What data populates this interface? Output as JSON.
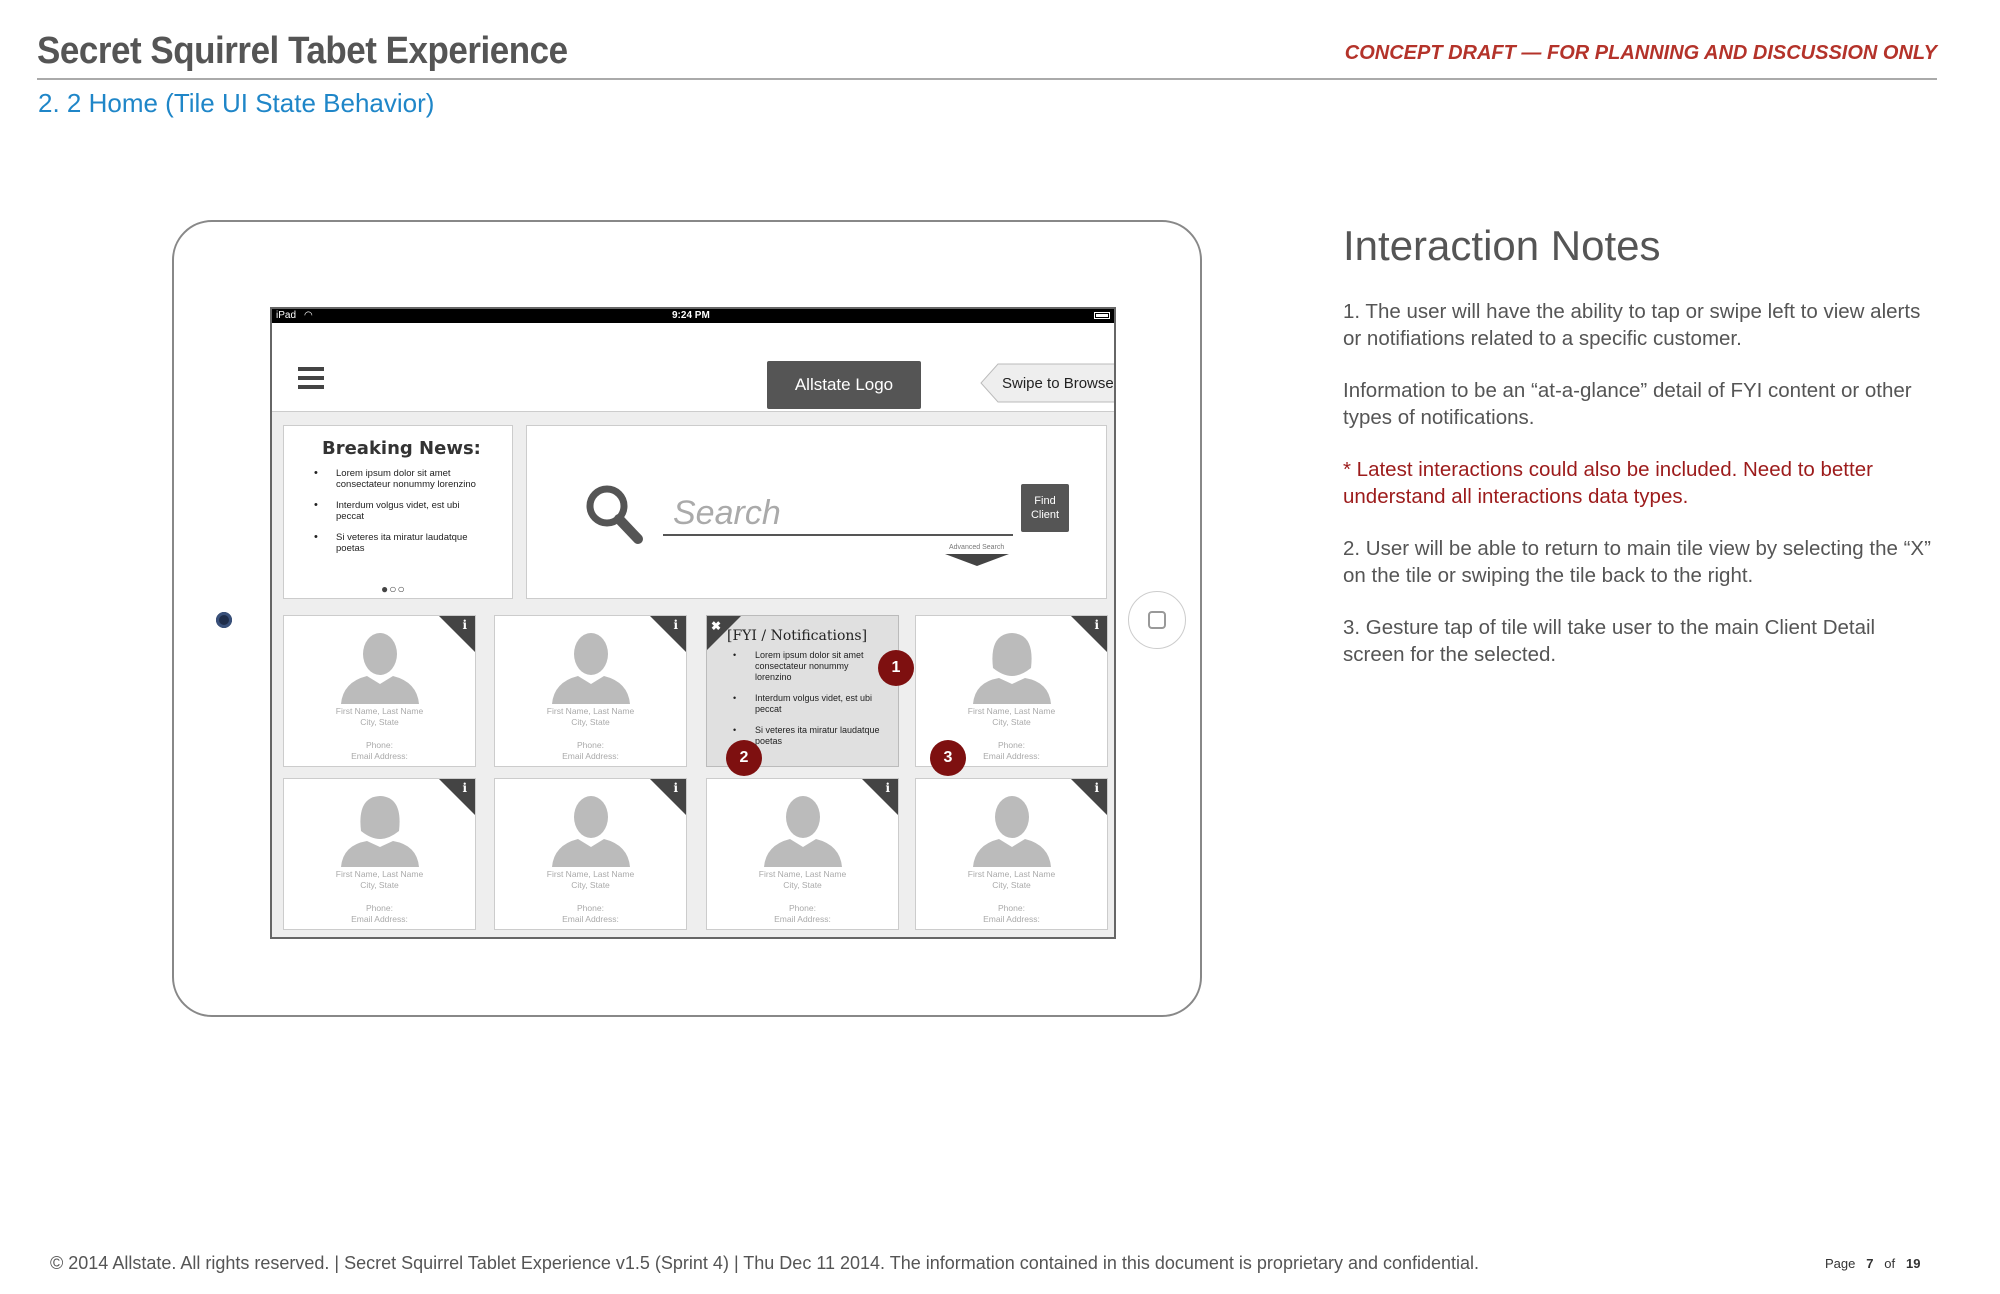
{
  "header": {
    "title": "Secret Squirrel Tabet Experience",
    "draft": "CONCEPT DRAFT — FOR PLANNING AND DISCUSSION ONLY",
    "subtitle": "2. 2 Home (Tile UI State Behavior)"
  },
  "screen": {
    "status": {
      "carrier": "iPad",
      "time": "9:24 PM"
    },
    "appbar": {
      "logo": "Allstate Logo",
      "swipe": "Swipe to Browse"
    },
    "news": {
      "title": "Breaking News:",
      "items": [
        "Lorem ipsum dolor sit amet consectateur nonummy lorenzino",
        "Interdum volgus videt, est ubi peccat",
        "Si veteres ita miratur laudatque poetas"
      ],
      "dots": "●○○"
    },
    "search": {
      "placeholder": "Search",
      "find_button": "Find Client",
      "advanced": "Advanced Search"
    },
    "fyi": {
      "title": "[FYI / Notifications]",
      "items": [
        "Lorem ipsum dolor sit amet consectateur nonummy lorenzino",
        "Interdum volgus videt, est ubi peccat",
        "Si veteres ita miratur laudatque poetas"
      ]
    },
    "tiles": [
      {
        "name": "First Name, Last Name",
        "location": "City, State",
        "phone": "Phone:",
        "email": "Email Address:"
      },
      {
        "name": "First Name, Last Name",
        "location": "City, State",
        "phone": "Phone:",
        "email": "Email Address:"
      },
      {
        "name": "First Name, Last Name",
        "location": "City, State",
        "phone": "Phone:",
        "email": "Email Address:"
      },
      {
        "name": "First Name, Last Name",
        "location": "City, State",
        "phone": "Phone:",
        "email": "Email Address:"
      },
      {
        "name": "First Name, Last Name",
        "location": "City, State",
        "phone": "Phone:",
        "email": "Email Address:"
      },
      {
        "name": "First Name, Last Name",
        "location": "City, State",
        "phone": "Phone:",
        "email": "Email Address:"
      },
      {
        "name": "First Name, Last Name",
        "location": "City, State",
        "phone": "Phone:",
        "email": "Email Address:"
      }
    ],
    "info_glyph": "i",
    "close_glyph": "✖",
    "markers": [
      "1",
      "2",
      "3"
    ]
  },
  "notes": {
    "title": "Interaction Notes",
    "n1": "1. The user will have the ability to tap or swipe left to view alerts or notifiations related to a specific customer.",
    "n1b": "Information to be an “at-a-glance” detail of FYI content or other types of notifications.",
    "n1c": "* Latest interactions could also be included. Need to better understand all interactions data types.",
    "n2": "2.  User will be able to return to main tile view by selecting the “X” on the tile or swiping the tile back to the right.",
    "n3": "3.  Gesture tap of tile will take user to the main Client Detail screen for the selected."
  },
  "footer": {
    "text": "© 2014 Allstate.  All rights reserved.  |  Secret Squirrel Tablet Experience v1.5 (Sprint 4)  |  Thu Dec 11 2014.  The information contained in this document is proprietary and confidential.",
    "page_label": "Page",
    "page": "7",
    "of_label": "of",
    "total": "19"
  },
  "colors": {
    "accent_blue": "#1f86c8",
    "draft_red": "#b4332a",
    "marker_red": "#7e1010"
  }
}
